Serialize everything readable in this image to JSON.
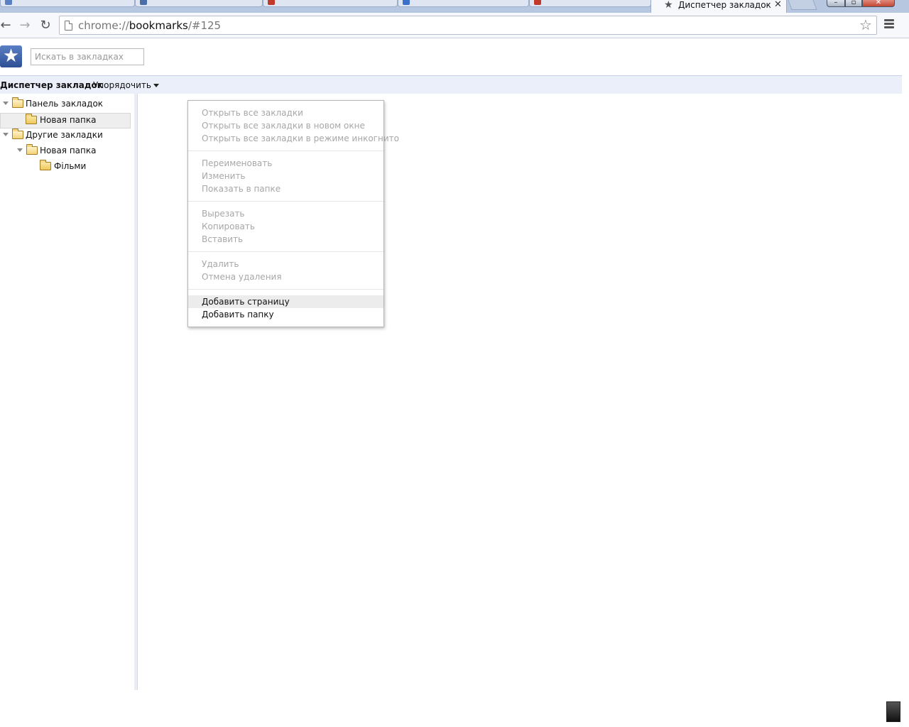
{
  "window": {
    "active_tab_title": "Диспетчер закладок",
    "tab_star_icon": "star-icon",
    "tab_close_icon": "close-icon"
  },
  "toolbar": {
    "back_icon": "arrow-left-icon",
    "forward_icon": "arrow-right-icon",
    "reload_icon": "reload-icon",
    "url_scheme": "chrome://",
    "url_host": "bookmarks",
    "url_path": "/#125",
    "bookmark_star_icon": "star-outline-icon",
    "menu_icon": "hamburger-menu-icon"
  },
  "search": {
    "placeholder": "Искать в закладках"
  },
  "header": {
    "title": "Диспетчер закладок",
    "organize_label": "Упорядочить"
  },
  "tree": {
    "items": [
      {
        "label": "Панель закладок",
        "level": 0,
        "expanded": true,
        "selected": false
      },
      {
        "label": "Новая папка",
        "level": 1,
        "expanded": false,
        "selected": true
      },
      {
        "label": "Другие закладки",
        "level": 0,
        "expanded": true,
        "selected": false
      },
      {
        "label": "Новая папка",
        "level": 1,
        "expanded": true,
        "selected": false
      },
      {
        "label": "Фільми",
        "level": 2,
        "expanded": false,
        "selected": false
      }
    ]
  },
  "context_menu": {
    "groups": [
      [
        {
          "label": "Открыть все закладки",
          "enabled": false
        },
        {
          "label": "Открыть все закладки в новом окне",
          "enabled": false
        },
        {
          "label": "Открыть все закладки в режиме инкогнито",
          "enabled": false
        }
      ],
      [
        {
          "label": "Переименовать",
          "enabled": false
        },
        {
          "label": "Изменить",
          "enabled": false
        },
        {
          "label": "Показать в папке",
          "enabled": false
        }
      ],
      [
        {
          "label": "Вырезать",
          "enabled": false
        },
        {
          "label": "Копировать",
          "enabled": false
        },
        {
          "label": "Вставить",
          "enabled": false
        }
      ],
      [
        {
          "label": "Удалить",
          "enabled": false
        },
        {
          "label": "Отмена удаления",
          "enabled": false
        }
      ],
      [
        {
          "label": "Добавить страницу",
          "enabled": true,
          "hovered": true
        },
        {
          "label": "Добавить папку",
          "enabled": true
        }
      ]
    ]
  },
  "colors": {
    "header_bar_bg": "#ebeff9",
    "logo_blue": "#2f4f95",
    "disabled_text": "#a7a7a7"
  }
}
